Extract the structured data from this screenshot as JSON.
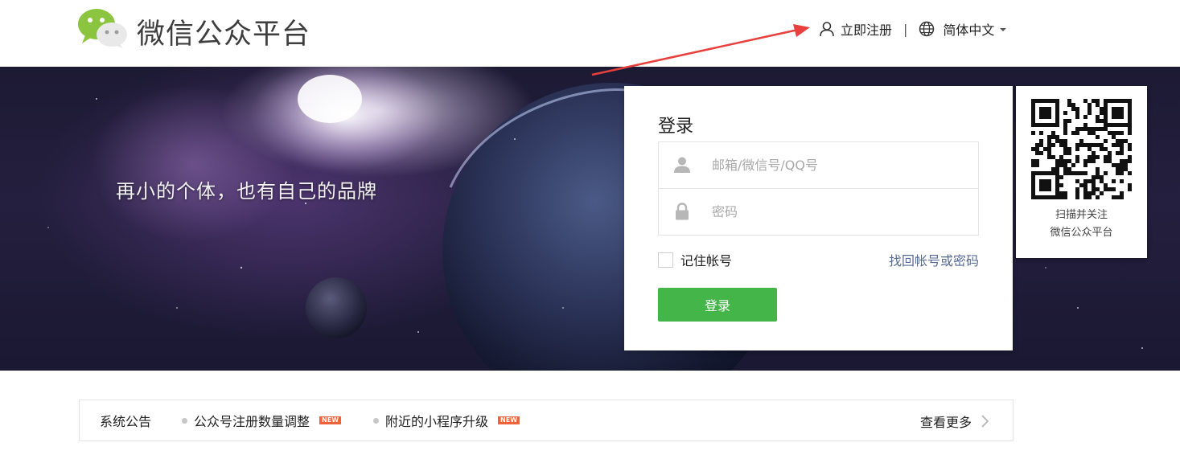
{
  "header": {
    "brand": "微信公众平台",
    "register_label": "立即注册",
    "separator": "|",
    "language_label": "简体中文",
    "icons": {
      "logo": "wechat-logo-icon",
      "register": "user-icon",
      "language": "globe-icon",
      "dropdown": "caret-down-icon"
    }
  },
  "banner": {
    "slogan": "再小的个体，也有自己的品牌"
  },
  "login": {
    "title": "登录",
    "username_placeholder": "邮箱/微信号/QQ号",
    "password_placeholder": "密码",
    "remember_label": "记住帐号",
    "forgot_label": "找回帐号或密码",
    "submit_label": "登录",
    "icons": {
      "user": "user-icon",
      "password": "lock-icon"
    }
  },
  "qr": {
    "caption_line1": "扫描并关注",
    "caption_line2": "微信公众平台"
  },
  "notice": {
    "label": "系统公告",
    "items": [
      {
        "text": "公众号注册数量调整",
        "badge": "NEW"
      },
      {
        "text": "附近的小程序升级",
        "badge": "NEW"
      }
    ],
    "more_label": "查看更多"
  },
  "colors": {
    "accent_green": "#44b549",
    "link_blue": "#576b95",
    "new_badge": "#f0623a",
    "annotation_arrow": "#e8403c"
  }
}
